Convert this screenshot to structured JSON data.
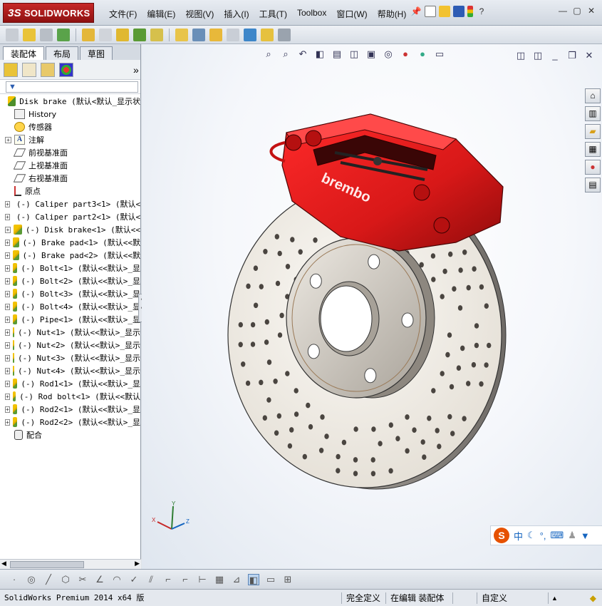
{
  "app": {
    "logo_ds": "3S",
    "logo_text": "SOLIDWORKS",
    "menus": [
      "文件(F)",
      "编辑(E)",
      "视图(V)",
      "插入(I)",
      "工具(T)",
      "Toolbox",
      "窗口(W)",
      "帮助(H)"
    ]
  },
  "panel": {
    "tabs": [
      "装配体",
      "布局",
      "草图"
    ],
    "active_tab": "装配体",
    "filter_placeholder": ""
  },
  "tree": {
    "root": "Disk brake (默认<默认_显示状",
    "fixed": [
      {
        "label": "History",
        "icon": "history-icon"
      },
      {
        "label": "传感器",
        "icon": "sensor-icon"
      },
      {
        "label": "注解",
        "icon": "annotation-icon",
        "expandable": true
      },
      {
        "label": "前视基准面",
        "icon": "plane-icon"
      },
      {
        "label": "上视基准面",
        "icon": "plane-icon"
      },
      {
        "label": "右视基准面",
        "icon": "plane-icon"
      },
      {
        "label": "原点",
        "icon": "origin-icon"
      }
    ],
    "components": [
      "(-) Caliper part3<1> (默认<",
      "(-) Caliper part2<1> (默认<",
      "(-) Disk brake<1> (默认<<",
      "(-) Brake pad<1> (默认<<默",
      "(-) Brake pad<2> (默认<<默",
      "(-) Bolt<1> (默认<<默认>_显",
      "(-) Bolt<2> (默认<<默认>_显",
      "(-) Bolt<3> (默认<<默认>_显",
      "(-) Bolt<4> (默认<<默认>_显",
      "(-) Pipe<1> (默认<<默认>_显",
      "(-) Nut<1> (默认<<默认>_显示",
      "(-) Nut<2> (默认<<默认>_显示",
      "(-) Nut<3> (默认<<默认>_显示",
      "(-) Nut<4> (默认<<默认>_显示",
      "(-) Rod1<1> (默认<<默认>_显",
      "(-) Rod bolt<1> (默认<<默认",
      "(-) Rod2<1> (默认<<默认>_显",
      "(-) Rod2<2> (默认<<默认>_显"
    ],
    "mates": "配合"
  },
  "viewport": {
    "caliper_brand": "brembo",
    "triad": {
      "x": "X",
      "y": "Y",
      "z": "Z"
    }
  },
  "ime": {
    "logo": "S",
    "mode": "中",
    "icons": [
      "moon-icon",
      "punctuation-icon",
      "keyboard-icon",
      "user-icon",
      "shirt-icon"
    ]
  },
  "status": {
    "product": "SolidWorks Premium 2014 x64 版",
    "state": "完全定义",
    "mode": "在编辑 装配体",
    "units": "自定义"
  },
  "colors": {
    "caliper": "#d81818",
    "disc": "#f4f1ec",
    "hub": "#d9d4cb",
    "accent": "#c62828"
  }
}
